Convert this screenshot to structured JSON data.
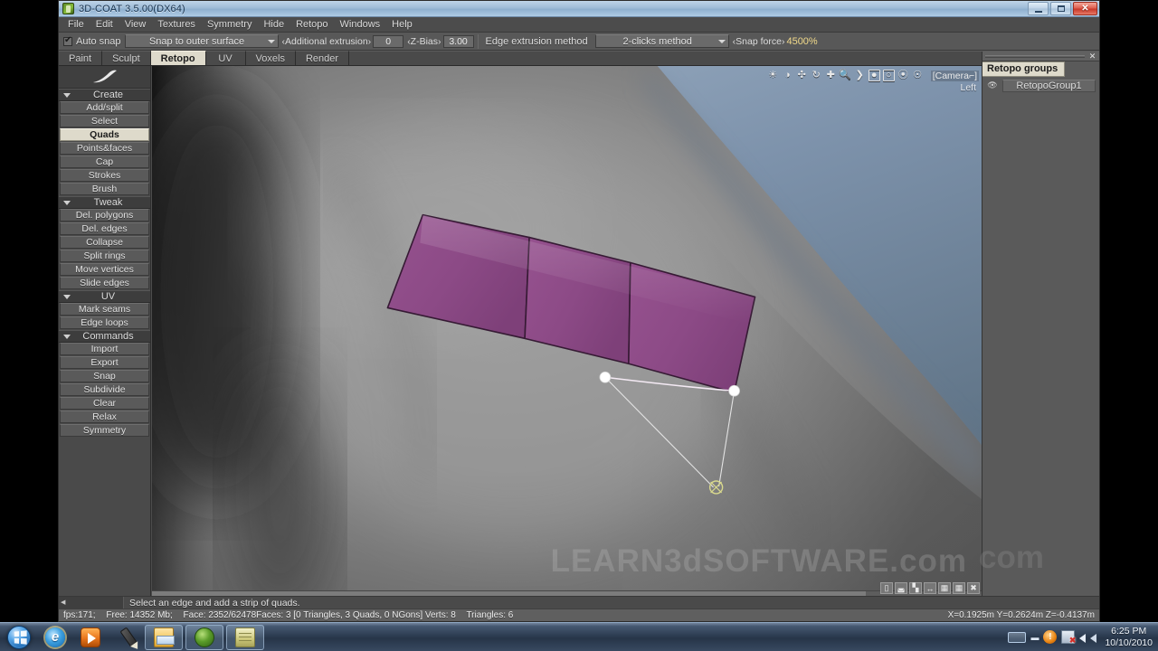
{
  "window": {
    "title": "3D-COAT 3.5.00(DX64)",
    "app_icon": "3dcoat-app-icon",
    "minimize": "–",
    "maximize": "❐",
    "close": "✕"
  },
  "menu": {
    "items": [
      "File",
      "Edit",
      "View",
      "Textures",
      "Symmetry",
      "Hide",
      "Retopo",
      "Windows",
      "Help"
    ]
  },
  "options_toolbar": {
    "auto_snap_label": "Auto snap",
    "auto_snap_checked": true,
    "snap_mode": "Snap to outer surface",
    "additional_extrusion_label": "‹Additional extrusion›",
    "additional_extrusion_value": "0",
    "z_bias_label": "‹Z-Bias›",
    "z_bias_value": "3.00",
    "edge_extrusion_method_label": "Edge extrusion method",
    "edge_extrusion_method_value": "2-clicks method",
    "snap_force_label": "‹Snap force›",
    "snap_force_value": "4500%"
  },
  "tabs": {
    "items": [
      "Paint",
      "Sculpt",
      "Retopo",
      "UV",
      "Voxels",
      "Render"
    ],
    "active": "Retopo"
  },
  "left_panel": {
    "brush_preview_icon": "stroke-preview-icon",
    "groups": [
      {
        "name": "Create",
        "expanded": true,
        "buttons": [
          "Add/split",
          "Select",
          "Quads",
          "Points&faces",
          "Cap",
          "Strokes",
          "Brush"
        ],
        "active": "Quads"
      },
      {
        "name": "Tweak",
        "expanded": true,
        "buttons": [
          "Del. polygons",
          "Del. edges",
          "Collapse",
          "Split rings",
          "Move vertices",
          "Slide edges"
        ],
        "active": ""
      },
      {
        "name": "UV",
        "expanded": true,
        "buttons": [
          "Mark seams",
          "Edge loops"
        ],
        "active": ""
      },
      {
        "name": "Commands",
        "expanded": true,
        "buttons": [
          "Import",
          "Export",
          "Snap",
          "Subdivide",
          "Clear",
          "Relax",
          "Symmetry"
        ],
        "active": ""
      }
    ]
  },
  "viewport": {
    "camera_label": "[Camera⌐]",
    "view_label": "Left",
    "watermark": "LEARN3dSOFTWARE.com",
    "toolbar_icons": [
      "light-icon",
      "contrast-icon",
      "wireframe-icon",
      "undo-rotate-icon",
      "move-icon",
      "zoom-icon",
      "play-icon",
      "render-square-icon",
      "camera-square-icon",
      "pivot-icon",
      "globe-icon"
    ],
    "bottom_icons": [
      "save-view-icon",
      "delete-view-icon",
      "chart-icon",
      "swap-icon",
      "grid-icon",
      "screen-icon",
      "close-view-icon"
    ],
    "mesh_color": "#8c4b86",
    "mesh_edge_color": "#3a1c38",
    "vertex_color": "#ffffff",
    "cursor_color": "#d8d88a"
  },
  "right_panel": {
    "title": "Retopo groups",
    "close_glyph": "✕",
    "items": [
      {
        "name": "RetopoGroup1",
        "visibility_icon": "eye-icon"
      }
    ]
  },
  "hint_bar": {
    "text": "Select an edge and add a strip of quads."
  },
  "status_bar": {
    "fps": "fps:171;",
    "free_memory": "Free: 14352 Mb;",
    "face": "Face: 2352/62478Faces: 3 [0 Triangles, 3 Quads, 0 NGons] Verts: 8",
    "triangles": "Triangles: 6",
    "coordinates": "X=0.1925m  Y=0.2624m  Z=-0.4137m"
  },
  "taskbar": {
    "start_label": "start-orb",
    "quick_launch": [
      {
        "name": "internet-explorer-icon"
      },
      {
        "name": "windows-media-player-icon"
      },
      {
        "name": "pen-tablet-icon"
      }
    ],
    "windows": [
      {
        "name": "explorer-window-icon"
      },
      {
        "name": "3dcoat-window-icon"
      },
      {
        "name": "notes-window-icon"
      }
    ],
    "tray": [
      {
        "name": "show-hidden-icons-icon"
      },
      {
        "name": "action-center-icon"
      },
      {
        "name": "network-icon"
      },
      {
        "name": "volume-icon"
      }
    ],
    "time": "6:25 PM",
    "date": "10/10/2010"
  }
}
